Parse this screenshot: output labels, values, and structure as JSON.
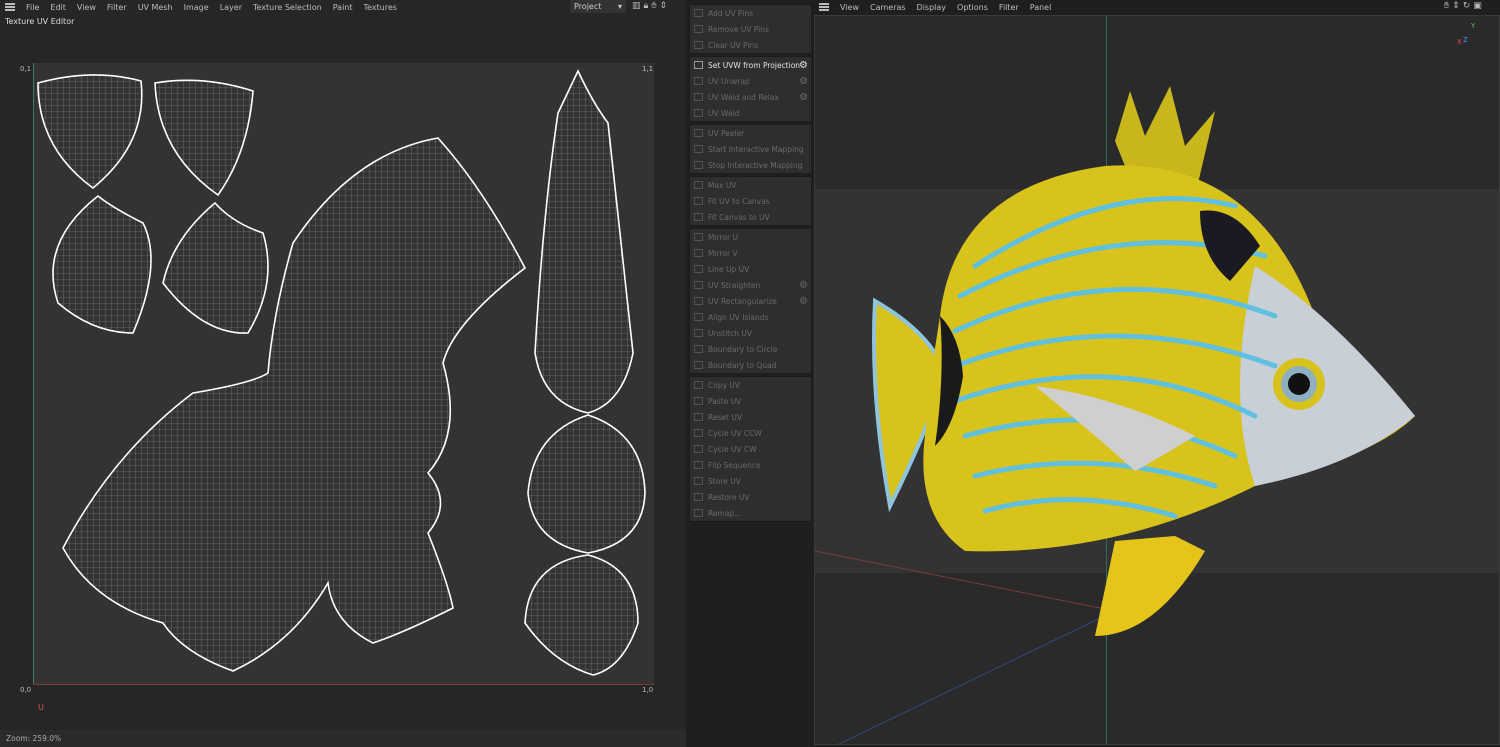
{
  "uv_editor": {
    "menu": [
      "File",
      "Edit",
      "View",
      "Filter",
      "UV Mesh",
      "Image",
      "Layer",
      "Texture Selection",
      "Paint",
      "Textures"
    ],
    "project_select": "Project",
    "title": "Texture UV Editor",
    "corners": {
      "top_left": "0,1",
      "top_right": "1,1",
      "bottom_left": "0,0",
      "bottom_right": "1,0"
    },
    "axis_u": "U",
    "status": "Zoom: 259.0%"
  },
  "tools": {
    "groups": [
      [
        {
          "label": "Add UV Pins"
        },
        {
          "label": "Remove UV Pins"
        },
        {
          "label": "Clear UV Pins"
        }
      ],
      [
        {
          "label": "Set UVW from Projection",
          "active": true,
          "gear": true
        },
        {
          "label": "UV Unwrap",
          "gear": true
        },
        {
          "label": "UV Weld and Relax",
          "gear": true
        },
        {
          "label": "UV Weld"
        }
      ],
      [
        {
          "label": "UV Peeler"
        },
        {
          "label": "Start Interactive Mapping"
        },
        {
          "label": "Stop Interactive Mapping"
        }
      ],
      [
        {
          "label": "Max UV"
        },
        {
          "label": "Fit UV to Canvas"
        },
        {
          "label": "Fit Canvas to UV"
        }
      ],
      [
        {
          "label": "Mirror U"
        },
        {
          "label": "Mirror V"
        },
        {
          "label": "Line Up UV"
        },
        {
          "label": "UV Straighten",
          "gear": true
        },
        {
          "label": "UV Rectangularize",
          "gear": true
        },
        {
          "label": "Align UV Islands"
        },
        {
          "label": "Unstitch UV"
        },
        {
          "label": "Boundary to Circle"
        },
        {
          "label": "Boundary to Quad"
        }
      ],
      [
        {
          "label": "Copy UV"
        },
        {
          "label": "Paste UV"
        },
        {
          "label": "Reset UV"
        },
        {
          "label": "Cycle UV CCW"
        },
        {
          "label": "Cycle UV CW"
        },
        {
          "label": "Flip Sequence"
        },
        {
          "label": "Store UV"
        },
        {
          "label": "Restore UV"
        },
        {
          "label": "Remap..."
        }
      ]
    ]
  },
  "viewport": {
    "menu": [
      "View",
      "Cameras",
      "Display",
      "Options",
      "Filter",
      "Panel"
    ],
    "axis": {
      "y": "Y",
      "z": "Z",
      "x": "X"
    },
    "colors": {
      "fish_yellow": "#d8c21c",
      "fish_blue": "#5fc0e0",
      "fish_white": "#c9cfd6"
    }
  }
}
